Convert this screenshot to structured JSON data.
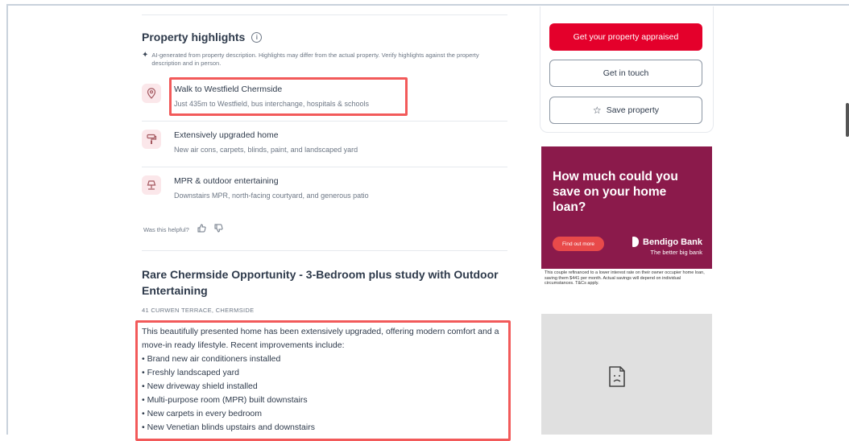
{
  "highlights": {
    "title": "Property highlights",
    "info_glyph": "i",
    "ai_note": "AI-generated from property description. Highlights may differ from the actual property. Verify highlights against the property description and in person.",
    "items": [
      {
        "title": "Walk to Westfield Chermside",
        "subtitle": "Just 435m to Westfield, bus interchange, hospitals & schools",
        "icon": "location-pin-icon"
      },
      {
        "title": "Extensively upgraded home",
        "subtitle": "New air cons, carpets, blinds, paint, and landscaped yard",
        "icon": "paint-roller-icon"
      },
      {
        "title": "MPR & outdoor entertaining",
        "subtitle": "Downstairs MPR, north-facing courtyard, and generous patio",
        "icon": "lamp-icon"
      }
    ],
    "helpful_label": "Was this helpful?"
  },
  "listing": {
    "title": "Rare Chermside Opportunity - 3-Bedroom plus study with Outdoor Entertaining",
    "address": "41 CURWEN TERRACE, CHERMSIDE",
    "intro": "This beautifully presented home has been extensively upgraded, offering modern comfort and a move-in ready lifestyle. Recent improvements include:",
    "improvements": [
      "Brand new air conditioners installed",
      "Freshly landscaped yard",
      "New driveway shield installed",
      "Multi-purpose room (MPR) built downstairs",
      "New carpets in every bedroom",
      "New Venetian blinds upstairs and downstairs"
    ]
  },
  "actions": {
    "appraise_label": "Get your property appraised",
    "touch_label": "Get in touch",
    "save_label": "Save property"
  },
  "ad": {
    "headline": "How much could you save on your home loan?",
    "cta": "Find out more",
    "brand": "Bendigo Bank",
    "tagline": "The better big bank",
    "fine_print": "This couple refinanced to a lower interest rate on their owner occupier home loan, saving them $441 per month. Actual savings will depend on individual circumstances. T&Cs apply."
  },
  "colors": {
    "brand_red": "#e4002b",
    "highlight_box": "#f25a5a",
    "ad_background": "#8b1a4b"
  }
}
